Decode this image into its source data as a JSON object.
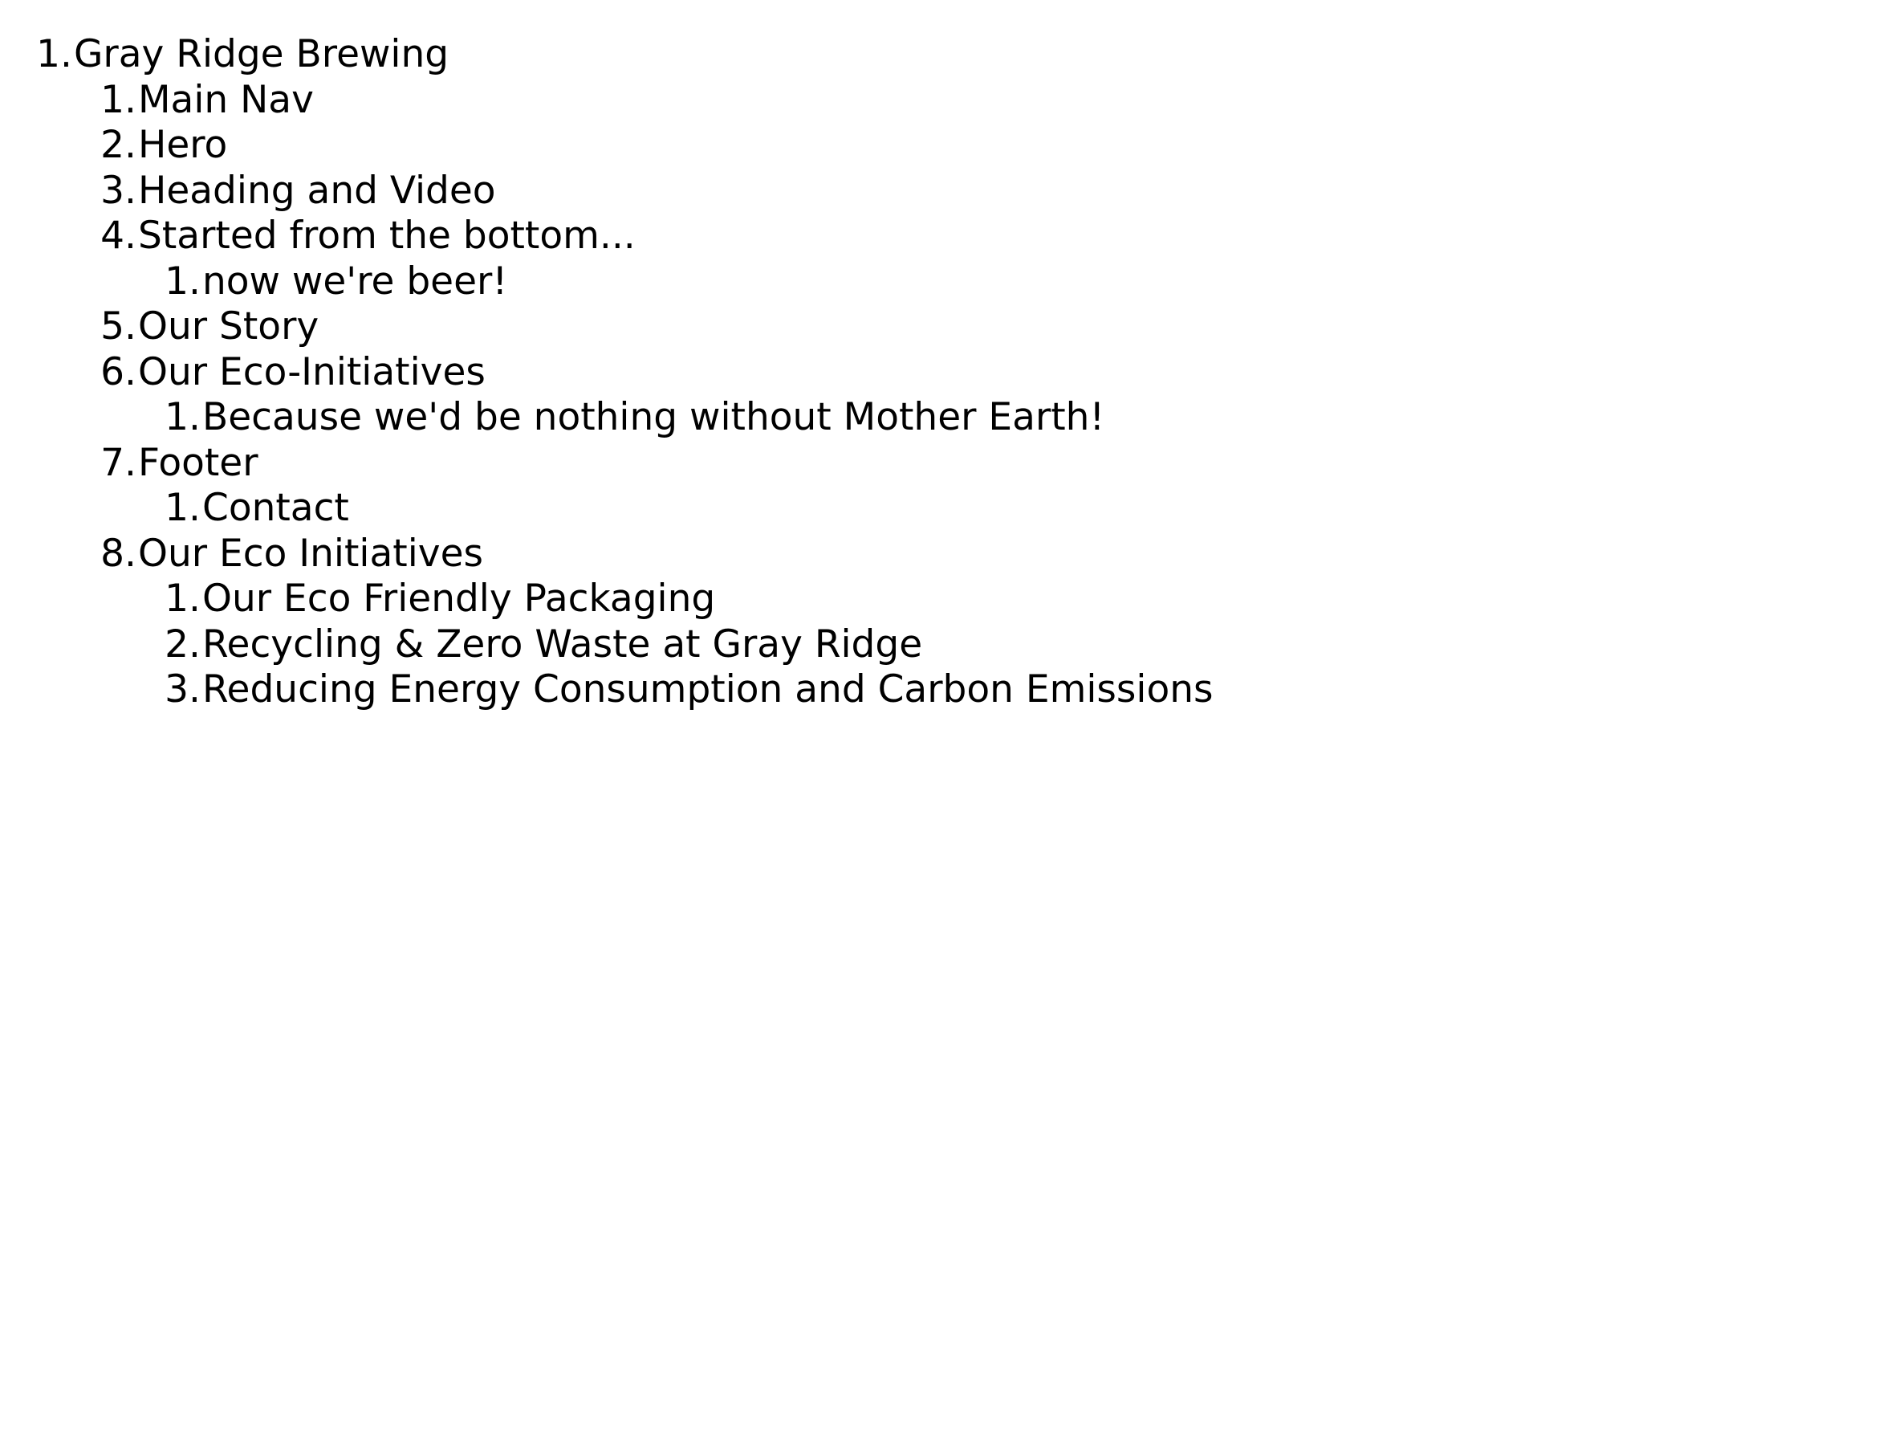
{
  "outline": {
    "root": {
      "number": "1.",
      "label": "Gray Ridge Brewing",
      "children": [
        {
          "number": "1.",
          "label": "Main Nav"
        },
        {
          "number": "2.",
          "label": "Hero"
        },
        {
          "number": "3.",
          "label": "Heading and Video"
        },
        {
          "number": "4.",
          "label": "Started from the bottom...",
          "children": [
            {
              "number": "1.",
              "label": "now we're beer!"
            }
          ]
        },
        {
          "number": "5.",
          "label": "Our Story"
        },
        {
          "number": "6.",
          "label": "Our Eco-Initiatives",
          "children": [
            {
              "number": "1.",
              "label": "Because we'd be nothing without Mother Earth!"
            }
          ]
        },
        {
          "number": "7.",
          "label": "Footer",
          "children": [
            {
              "number": "1.",
              "label": "Contact"
            }
          ]
        },
        {
          "number": "8.",
          "label": "Our Eco Initiatives",
          "children": [
            {
              "number": "1.",
              "label": "Our Eco Friendly Packaging"
            },
            {
              "number": "2.",
              "label": "Recycling & Zero Waste at Gray Ridge"
            },
            {
              "number": "3.",
              "label": "Reducing Energy Consumption and Carbon Emissions"
            }
          ]
        }
      ]
    }
  }
}
